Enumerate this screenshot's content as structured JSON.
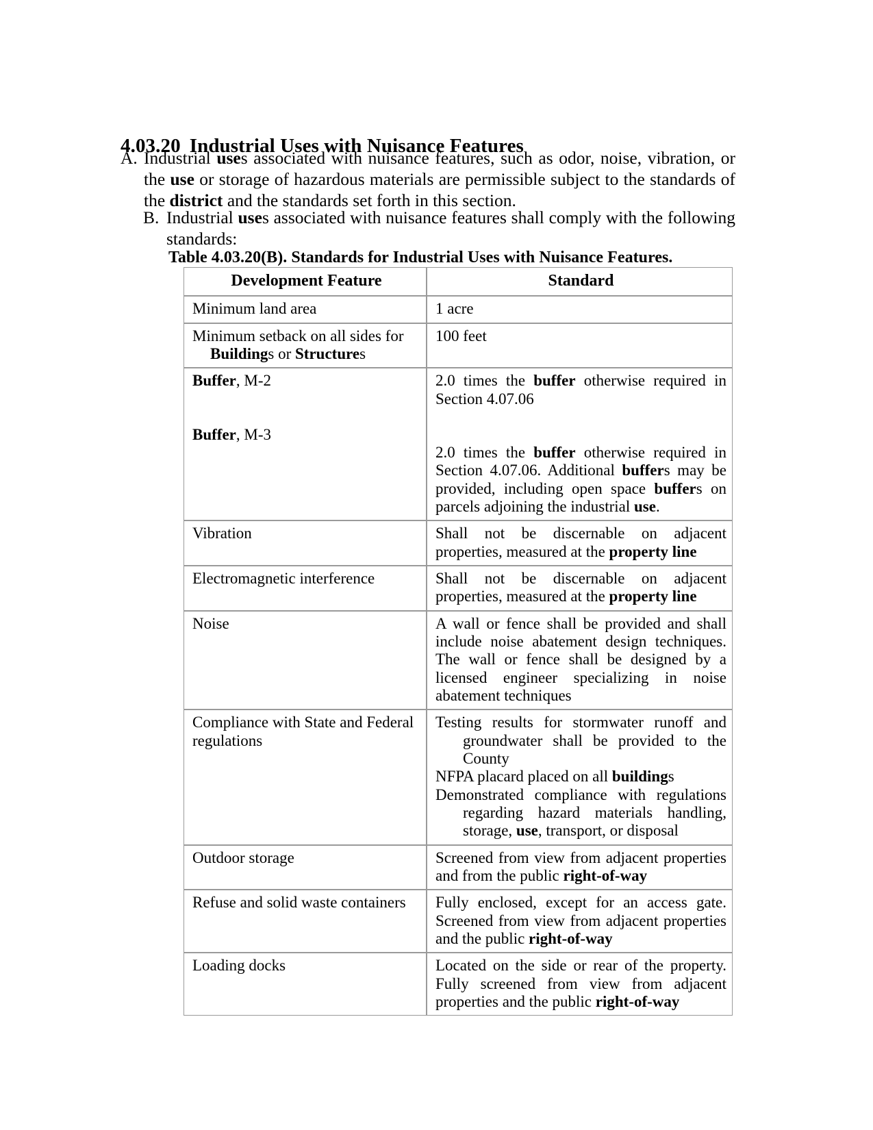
{
  "section": {
    "number": "4.03.20",
    "title": "Industrial Uses with Nuisance Features"
  },
  "paragraphs": [
    {
      "marker": "A.",
      "segments": [
        {
          "text": "Industrial ",
          "bold": false
        },
        {
          "text": "use",
          "bold": true
        },
        {
          "text": "s associated with nuisance features, such as odor, noise, vibration, or the ",
          "bold": false
        },
        {
          "text": "use",
          "bold": true
        },
        {
          "text": " or storage of hazardous materials are permissible subject to the standards of the ",
          "bold": false
        },
        {
          "text": "district",
          "bold": true
        },
        {
          "text": " and the standards set forth in this section.",
          "bold": false
        }
      ]
    },
    {
      "marker": "B.",
      "segments": [
        {
          "text": "Industrial ",
          "bold": false
        },
        {
          "text": "use",
          "bold": true
        },
        {
          "text": "s associated with nuisance features shall comply with the following standards:",
          "bold": false
        }
      ]
    }
  ],
  "table": {
    "caption": "Table 4.03.20(B).  Standards for Industrial Uses with Nuisance Features.",
    "caption_label": "Table 4.03.20(B).",
    "caption_text": "Standards for Industrial Uses with Nuisance Features.",
    "headers": {
      "feature": "Development Feature",
      "standard": "Standard"
    },
    "rows": [
      {
        "feature_segments": [
          {
            "text": "Minimum land area",
            "bold": false
          }
        ],
        "standard_segments": [
          {
            "text": "1 acre",
            "bold": false
          }
        ]
      },
      {
        "feature_segments": [
          {
            "text": "Minimum setback on all sides for",
            "bold": false
          },
          {
            "break": "indent"
          },
          {
            "text": "Building",
            "bold": true
          },
          {
            "text": "s or ",
            "bold": false
          },
          {
            "text": "Structure",
            "bold": true
          },
          {
            "text": "s",
            "bold": false
          }
        ],
        "standard_segments": [
          {
            "text": "100 feet",
            "bold": false
          }
        ]
      },
      {
        "feature_segments": [
          {
            "text": "Buffer",
            "bold": true
          },
          {
            "text": ", M-2",
            "bold": false
          },
          {
            "break": "gap"
          },
          {
            "text": "Buffer",
            "bold": true
          },
          {
            "text": ", M-3",
            "bold": false
          }
        ],
        "standard_segments": [
          {
            "text": "2.0 times the ",
            "bold": false
          },
          {
            "text": "buffer",
            "bold": true
          },
          {
            "text": " otherwise required in Section 4.07.06",
            "bold": false
          },
          {
            "break": "gap"
          },
          {
            "text": "2.0 times the ",
            "bold": false
          },
          {
            "text": "buffer",
            "bold": true
          },
          {
            "text": " otherwise required in Section 4.07.06.  Additional ",
            "bold": false
          },
          {
            "text": "buffer",
            "bold": true
          },
          {
            "text": "s may be provided, including open space ",
            "bold": false
          },
          {
            "text": "buffer",
            "bold": true
          },
          {
            "text": "s on parcels adjoining the industrial ",
            "bold": false
          },
          {
            "text": "use",
            "bold": true
          },
          {
            "text": ".",
            "bold": false
          }
        ]
      },
      {
        "feature_segments": [
          {
            "text": "Vibration",
            "bold": false
          }
        ],
        "standard_segments": [
          {
            "text": "Shall not be discernable on adjacent properties, measured at the ",
            "bold": false
          },
          {
            "text": "property line",
            "bold": true
          }
        ]
      },
      {
        "feature_segments": [
          {
            "text": "Electromagnetic interference",
            "bold": false
          }
        ],
        "standard_segments": [
          {
            "text": "Shall not be discernable on adjacent properties, measured at the ",
            "bold": false
          },
          {
            "text": "property line",
            "bold": true
          }
        ]
      },
      {
        "feature_segments": [
          {
            "text": "Noise",
            "bold": false
          }
        ],
        "standard_segments": [
          {
            "text": "A wall or fence shall be provided and shall include noise abatement design techniques.  The wall or fence shall be designed by a licensed engineer specializing in noise abatement techniques",
            "bold": false
          }
        ]
      },
      {
        "feature_segments": [
          {
            "text": "Compliance with State and Federal regulations",
            "bold": false
          }
        ],
        "standard_list": [
          [
            {
              "text": "Testing results for stormwater runoff and groundwater shall be provided to the County",
              "bold": false
            }
          ],
          [
            {
              "text": "NFPA placard placed on all ",
              "bold": false
            },
            {
              "text": "building",
              "bold": true
            },
            {
              "text": "s",
              "bold": false
            }
          ],
          [
            {
              "text": "Demonstrated compliance with regulations regarding hazard materials handling, storage, ",
              "bold": false
            },
            {
              "text": "use",
              "bold": true
            },
            {
              "text": ", transport, or disposal",
              "bold": false
            }
          ]
        ]
      },
      {
        "feature_segments": [
          {
            "text": "Outdoor storage",
            "bold": false
          }
        ],
        "standard_segments": [
          {
            "text": "Screened from view from adjacent properties and from the public ",
            "bold": false
          },
          {
            "text": "right-of-way",
            "bold": true
          }
        ]
      },
      {
        "feature_segments": [
          {
            "text": "Refuse and solid waste containers",
            "bold": false
          }
        ],
        "standard_segments": [
          {
            "text": "Fully enclosed, except for an access gate.  Screened from view from adjacent properties and the public ",
            "bold": false
          },
          {
            "text": "right-of-way",
            "bold": true
          }
        ]
      },
      {
        "feature_segments": [
          {
            "text": "Loading docks",
            "bold": false
          }
        ],
        "standard_segments": [
          {
            "text": "Located on the side or rear of the property.  Fully screened from view from adjacent properties and the public ",
            "bold": false
          },
          {
            "text": "right-of-way",
            "bold": true
          }
        ]
      }
    ]
  },
  "colors": {
    "text": "#000000",
    "page_background": "#ffffff",
    "table_border": "#9a9a9a"
  }
}
